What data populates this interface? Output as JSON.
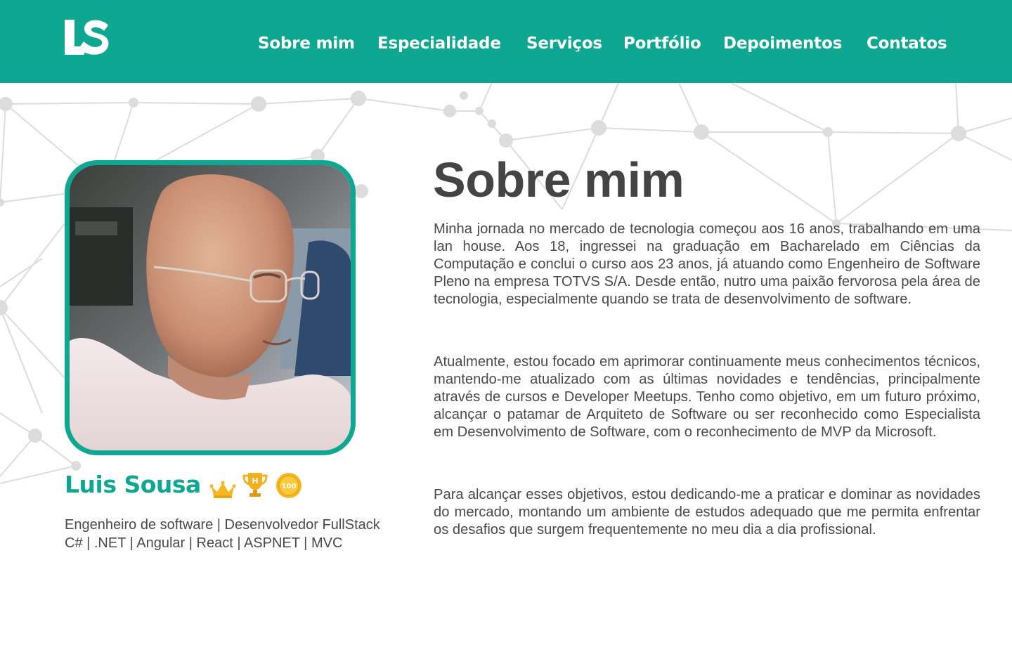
{
  "colors": {
    "brand": "#0ea791",
    "text": "#4a4a4a",
    "title": "#444444"
  },
  "header": {
    "logo_text": "LS",
    "nav": [
      {
        "label": "Sobre mim"
      },
      {
        "label": "Especialidade"
      },
      {
        "label": "Serviços"
      },
      {
        "label": "Portfólio"
      },
      {
        "label": "Depoimentos"
      },
      {
        "label": "Contatos"
      }
    ]
  },
  "profile": {
    "name": "Luis Sousa",
    "badges": [
      "crown-icon",
      "trophy-icon",
      "coin-100-icon"
    ],
    "coin_label": "100",
    "trophy_label": "H",
    "role": "Engenheiro de software | Desenvolvedor FullStack",
    "stack": "C# | .NET | Angular | React | ASPNET | MVC"
  },
  "about": {
    "title": "Sobre mim",
    "paragraphs": [
      "Minha jornada no mercado de tecnologia começou aos 16 anos, trabalhando em uma lan house. Aos 18, ingressei na graduação em Bacharelado em Ciências da Computação e conclui o curso aos 23 anos, já  atuando como Engenheiro de Software Pleno na empresa TOTVS S/A. Desde então, nutro uma paixão fervorosa pela área de tecnologia, especialmente quando se trata de desenvolvimento de software.",
      "Atualmente, estou focado em aprimorar continuamente meus conhecimentos técnicos, mantendo-me atualizado com as últimas novidades e tendências, principalmente através de cursos e Developer Meetups. Tenho como objetivo, em um futuro próximo, alcançar o patamar de Arquiteto de Software ou ser reconhecido como Especialista em  Desenvolvimento de Software, com o reconhecimento de MVP da Microsoft.",
      "Para alcançar esses objetivos, estou dedicando-me a praticar e dominar as novidades do mercado, montando um ambiente de estudos adequado que me permita enfrentar os desafios que surgem frequentemente no meu dia a dia profissional."
    ]
  }
}
